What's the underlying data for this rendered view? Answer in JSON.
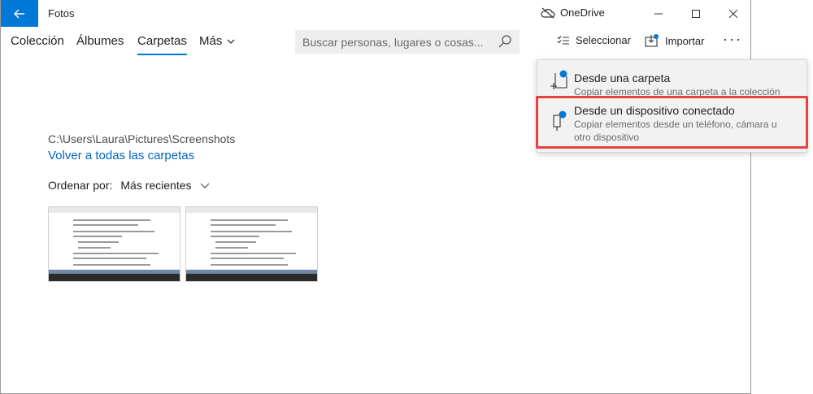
{
  "app": {
    "title": "Fotos"
  },
  "titlebar": {
    "onedrive_label": "OneDrive"
  },
  "nav": {
    "tabs": [
      {
        "label": "Colección"
      },
      {
        "label": "Álbumes"
      },
      {
        "label": "Carpetas"
      },
      {
        "label": "Más"
      }
    ],
    "active_tab": "Carpetas"
  },
  "search": {
    "placeholder": "Buscar personas, lugares o cosas..."
  },
  "commands": {
    "select_label": "Seleccionar",
    "import_label": "Importar"
  },
  "folder": {
    "path": "C:\\Users\\Laura\\Pictures\\Screenshots",
    "back_link": "Volver a todas las carpetas"
  },
  "sort": {
    "label": "Ordenar por:",
    "value": "Más recientes"
  },
  "import_menu": {
    "items": [
      {
        "title": "Desde una carpeta",
        "description": "Copiar elementos de una carpeta a la colección"
      },
      {
        "title": "Desde un dispositivo conectado",
        "description": "Copiar elementos desde un teléfono, cámara u otro dispositivo"
      }
    ]
  },
  "colors": {
    "accent": "#0078d7",
    "highlight": "#e8423f",
    "link": "#0067c0"
  }
}
